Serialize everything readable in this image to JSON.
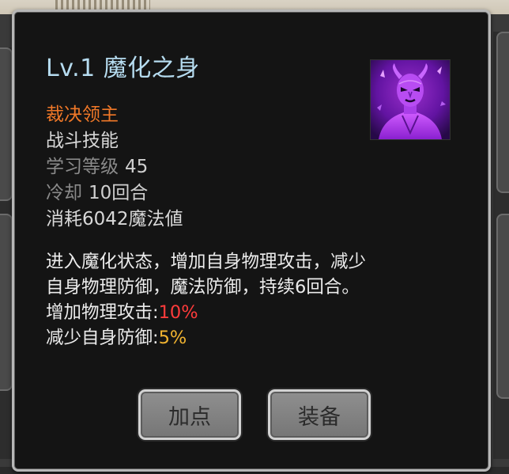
{
  "skill": {
    "level": "Lv.1",
    "name": "魔化之身",
    "faction": "裁决领主",
    "type": "战斗技能",
    "learn_level_label": "学习等级",
    "learn_level_value": "45",
    "cooldown_label": "冷却",
    "cooldown_value": "10回合",
    "cost": "消耗6042魔法値",
    "icon": "demon-skill-icon"
  },
  "description": {
    "line1": "进入魔化状态，增加自身物理攻击，减少",
    "line2": "自身物理防御，魔法防御，持续6回合。",
    "attack_label": "增加物理攻击:",
    "attack_value": "10%",
    "defense_label": "减少自身防御:",
    "defense_value": "5%"
  },
  "buttons": {
    "add_point": "加点",
    "equip": "装备"
  },
  "colors": {
    "title": "#b6dcf0",
    "faction": "#f07828",
    "attack_value": "#ff3b3b",
    "defense_value": "#f2b430"
  }
}
